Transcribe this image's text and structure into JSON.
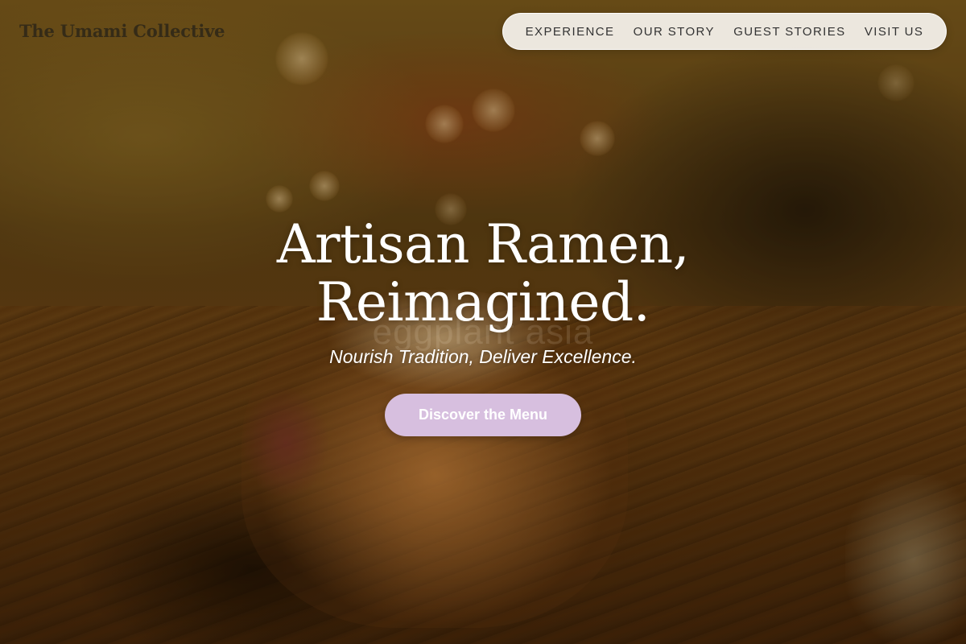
{
  "brand": {
    "name": "The Umami Collective"
  },
  "nav": {
    "items": [
      {
        "label": "EXPERIENCE"
      },
      {
        "label": "OUR STORY"
      },
      {
        "label": "GUEST STORIES"
      },
      {
        "label": "VISIT US"
      }
    ]
  },
  "hero": {
    "headline_line1": "Artisan Ramen,",
    "headline_line2": "Reimagined.",
    "tagline": "Nourish Tradition, Deliver Excellence.",
    "cta_label": "Discover the Menu",
    "ghost_text": "eggplant asia"
  },
  "colors": {
    "cta_background": "#d7bfdf",
    "nav_background": "#f6f3ee",
    "text_light": "#ffffff",
    "nav_text": "#333333"
  }
}
